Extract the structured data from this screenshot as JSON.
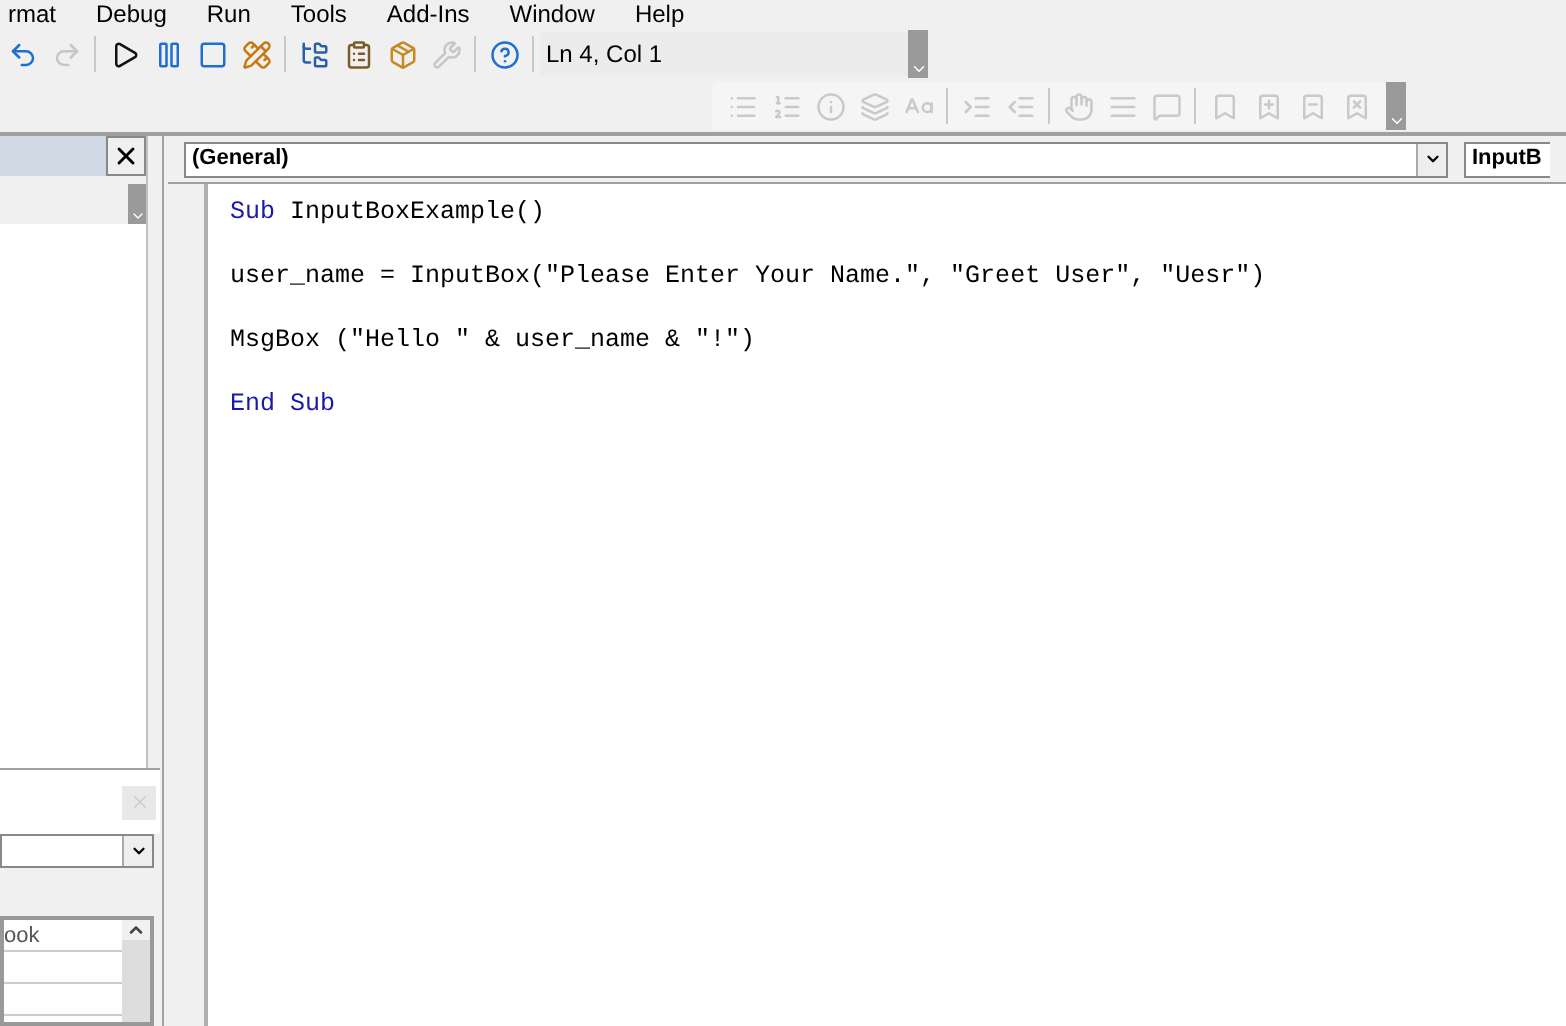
{
  "menu": [
    "rmat",
    "Debug",
    "Run",
    "Tools",
    "Add-Ins",
    "Window",
    "Help"
  ],
  "toolbar": {
    "buttons": [
      {
        "kind": "undo",
        "disabled": false
      },
      {
        "kind": "redo",
        "disabled": true
      },
      {
        "kind": "run",
        "disabled": false
      },
      {
        "kind": "pause",
        "disabled": false
      },
      {
        "kind": "stop",
        "disabled": false
      },
      {
        "kind": "design",
        "disabled": false
      },
      {
        "kind": "explorer",
        "disabled": false
      },
      {
        "kind": "properties",
        "disabled": false
      },
      {
        "kind": "browser",
        "disabled": false
      },
      {
        "kind": "toolbox",
        "disabled": true
      },
      {
        "kind": "help",
        "disabled": false
      }
    ],
    "position": "Ln 4, Col 1"
  },
  "edit_toolbar": {
    "buttons": [
      {
        "kind": "list",
        "disabled": true
      },
      {
        "kind": "constants",
        "disabled": true
      },
      {
        "kind": "info",
        "disabled": true
      },
      {
        "kind": "params",
        "disabled": true
      },
      {
        "kind": "word",
        "disabled": true
      },
      {
        "kind": "indent",
        "disabled": true
      },
      {
        "kind": "outdent",
        "disabled": true
      },
      {
        "kind": "breakpoint",
        "disabled": true
      },
      {
        "kind": "comment",
        "disabled": true
      },
      {
        "kind": "uncomment",
        "disabled": true
      },
      {
        "kind": "bookmark",
        "disabled": true
      },
      {
        "kind": "next-bookmark",
        "disabled": true
      },
      {
        "kind": "prev-bookmark",
        "disabled": true
      },
      {
        "kind": "clear-bookmarks",
        "disabled": true
      }
    ]
  },
  "code_window": {
    "object": "(General)",
    "procedure": "InputB",
    "lines": [
      {
        "segments": [
          {
            "text": "Sub",
            "kind": "keyword"
          },
          {
            "text": " InputBoxExample()",
            "kind": "plain"
          }
        ]
      },
      {
        "segments": [
          {
            "text": "user_name = InputBox(\"Please Enter Your Name.\", \"Greet User\", \"Uesr\")",
            "kind": "plain"
          }
        ]
      },
      {
        "segments": [
          {
            "text": "MsgBox (\"Hello \" & user_name & \"!\")",
            "kind": "plain"
          }
        ]
      },
      {
        "segments": [
          {
            "text": "End Sub",
            "kind": "keyword"
          }
        ]
      }
    ]
  },
  "properties": {
    "rows": [
      "ook"
    ]
  }
}
